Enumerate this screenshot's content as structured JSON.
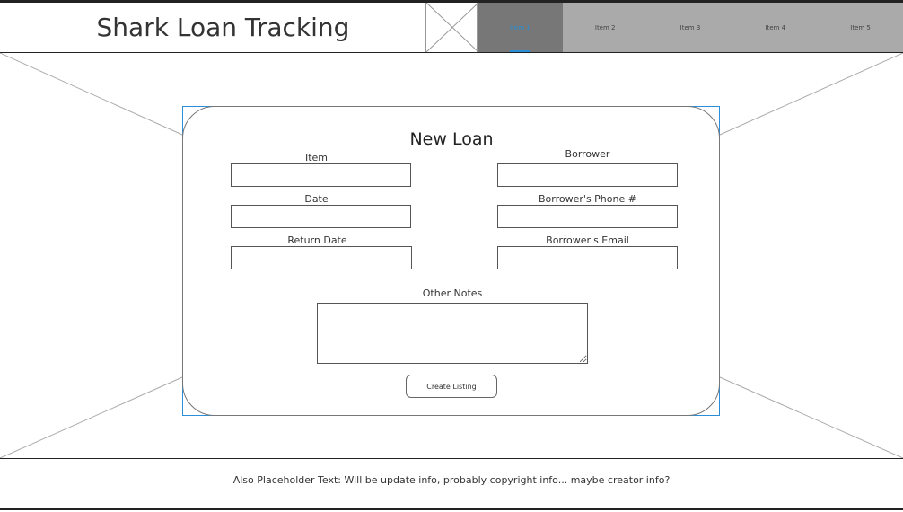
{
  "header": {
    "title": "Shark Loan Tracking",
    "logo_icon": "image-placeholder-icon"
  },
  "nav": {
    "items": [
      {
        "label": "Item 1",
        "active": true
      },
      {
        "label": "Item 2",
        "active": false
      },
      {
        "label": "Item 3",
        "active": false
      },
      {
        "label": "Item 4",
        "active": false
      },
      {
        "label": "Item 5",
        "active": false
      }
    ],
    "active_color": "#2a8fd8"
  },
  "form": {
    "title": "New Loan",
    "fields": {
      "item": {
        "label": "Item",
        "value": ""
      },
      "date": {
        "label": "Date",
        "value": ""
      },
      "return_date": {
        "label": "Return Date",
        "value": ""
      },
      "borrower": {
        "label": "Borrower",
        "value": ""
      },
      "borrower_phone": {
        "label": "Borrower's Phone #",
        "value": ""
      },
      "borrower_email": {
        "label": "Borrower's Email",
        "value": ""
      },
      "other_notes": {
        "label": "Other Notes",
        "value": ""
      }
    },
    "submit_label": "Create Listing"
  },
  "footer": {
    "text": "Also Placeholder Text: Will be update info, probably copyright info... maybe creator info?"
  }
}
